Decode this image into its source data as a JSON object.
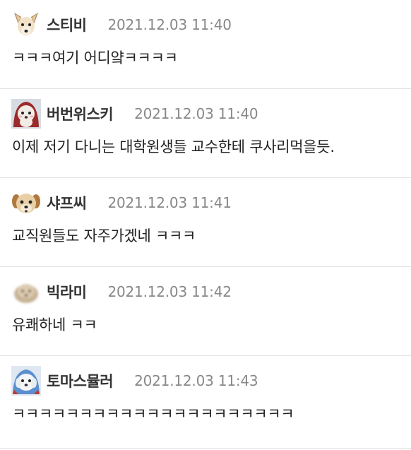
{
  "comments": [
    {
      "avatar_icon": "dog-face-icon",
      "author": "스티비",
      "date": "2021.12.03 11:40",
      "text": "ㅋㅋㅋ여기 어디얔ㅋㅋㅋㅋ"
    },
    {
      "avatar_icon": "red-hood-character-icon",
      "author": "버번위스키",
      "date": "2021.12.03 11:40",
      "text": "이제 저기 다니는 대학원생들 교수한테 쿠사리먹을듯."
    },
    {
      "avatar_icon": "puppy-face-icon",
      "author": "샤프씨",
      "date": "2021.12.03 11:41",
      "text": "교직원들도 자주가겠네 ㅋㅋㅋ"
    },
    {
      "avatar_icon": "blurry-dog-icon",
      "author": "빅라미",
      "date": "2021.12.03 11:42",
      "text": "유쾌하네 ㅋㅋ"
    },
    {
      "avatar_icon": "white-dog-blue-hood-icon",
      "author": "토마스뮬러",
      "date": "2021.12.03 11:43",
      "text": "ㅋㅋㅋㅋㅋㅋㅋㅋㅋㅋㅋㅋㅋㅋㅋㅋㅋㅋㅋㅋㅋ"
    }
  ],
  "colors": {
    "author": "#333333",
    "date": "#888888",
    "text": "#222222",
    "divider": "#e2e2e2"
  }
}
